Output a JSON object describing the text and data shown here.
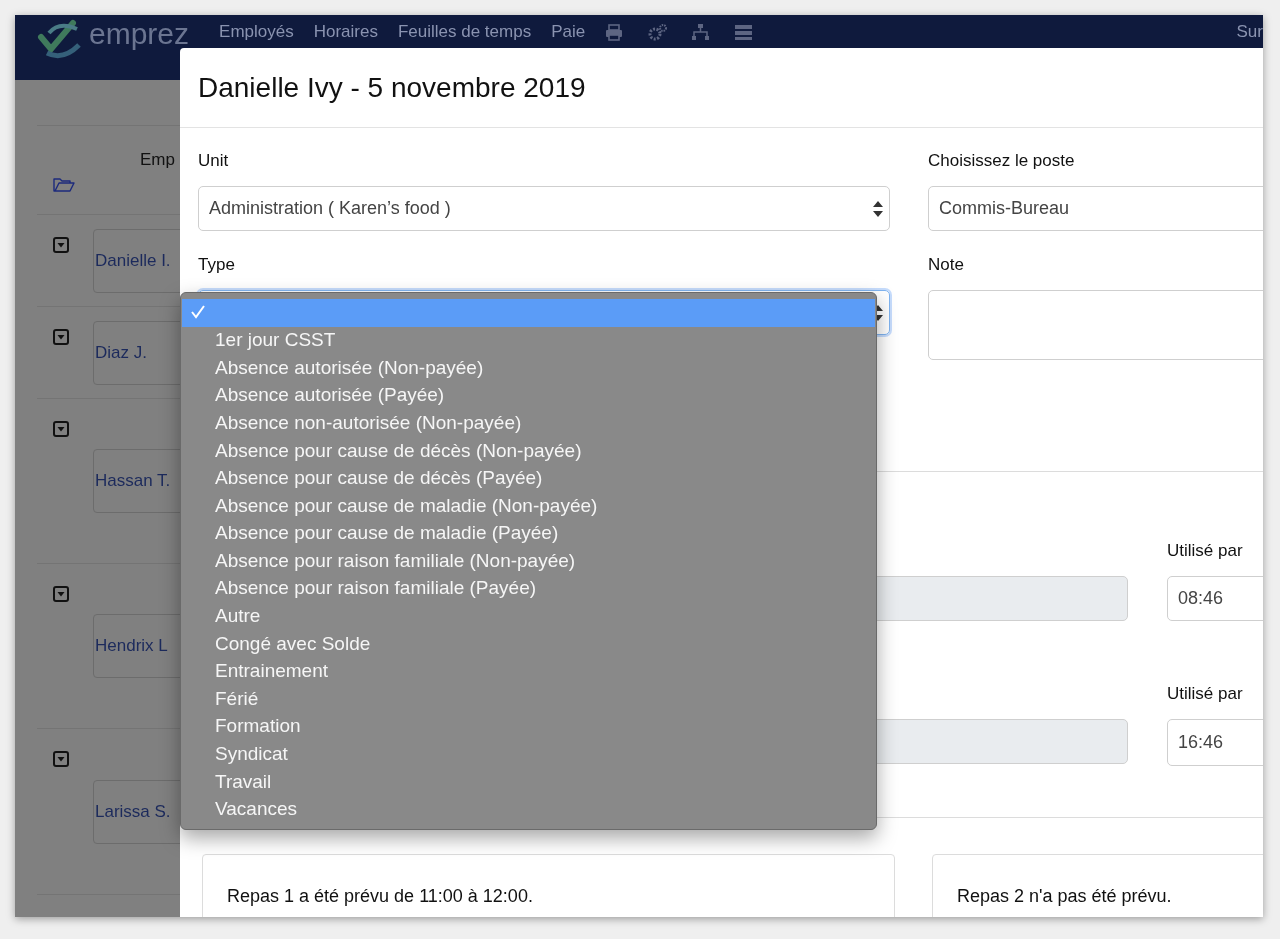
{
  "navbar": {
    "logo": "emprez",
    "links": [
      "Employés",
      "Horaires",
      "Feuilles de temps",
      "Paie"
    ],
    "user_link": "Sur"
  },
  "employee_list": {
    "header": "Emp",
    "rows": [
      {
        "name": "Danielle I."
      },
      {
        "name": "Diaz J."
      },
      {
        "name": "Hassan T."
      },
      {
        "name": "Hendrix L"
      },
      {
        "name": "Larissa S."
      }
    ]
  },
  "modal": {
    "title": "Danielle Ivy - 5 novembre 2019",
    "unit": {
      "label": "Unit",
      "value": "Administration ( Karen’s food )"
    },
    "poste": {
      "label": "Choisissez le poste",
      "value": "Commis-Bureau"
    },
    "type": {
      "label": "Type"
    },
    "note": {
      "label": "Note"
    },
    "times": [
      {
        "label": "Utilisé par",
        "value": "08:46"
      },
      {
        "label": "Utilisé par",
        "value": "16:46"
      }
    ],
    "meals": [
      "Repas 1 a été prévu de 11:00 à 12:00.",
      "Repas 2 n'a pas été prévu."
    ]
  },
  "type_dropdown": {
    "options": [
      {
        "selected": true
      },
      {
        "label": "1er jour CSST",
        "selected": false
      },
      {
        "label": "Absence autorisée (Non-payée)",
        "selected": false
      },
      {
        "label": "Absence autorisée (Payée)",
        "selected": false
      },
      {
        "label": "Absence non-autorisée (Non-payée)",
        "selected": false
      },
      {
        "label": "Absence pour cause de décès (Non-payée)",
        "selected": false
      },
      {
        "label": "Absence pour cause de décès (Payée)",
        "selected": false
      },
      {
        "label": "Absence pour cause de maladie (Non-payée)",
        "selected": false
      },
      {
        "label": "Absence pour cause de maladie (Payée)",
        "selected": false
      },
      {
        "label": "Absence pour raison familiale (Non-payée)",
        "selected": false
      },
      {
        "label": "Absence pour raison familiale (Payée)",
        "selected": false
      },
      {
        "label": "Autre",
        "selected": false
      },
      {
        "label": "Congé avec Solde",
        "selected": false
      },
      {
        "label": "Entrainement",
        "selected": false
      },
      {
        "label": "Férié",
        "selected": false
      },
      {
        "label": "Formation",
        "selected": false
      },
      {
        "label": "Syndicat",
        "selected": false
      },
      {
        "label": "Travail",
        "selected": false
      },
      {
        "label": "Vacances",
        "selected": false
      }
    ]
  }
}
